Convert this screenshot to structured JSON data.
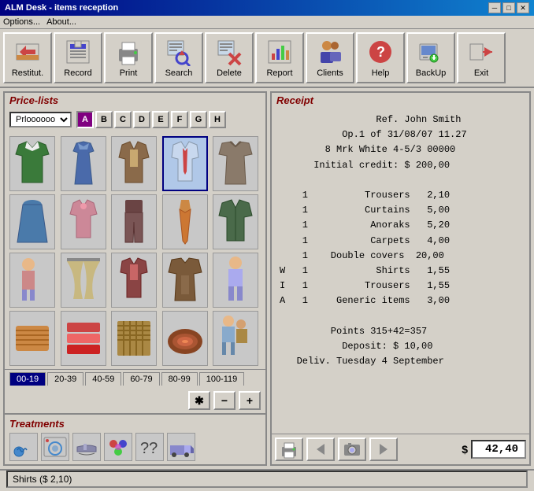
{
  "window": {
    "title": "ALM Desk - items reception",
    "minimize": "─",
    "maximize": "□",
    "close": "✕"
  },
  "menu": {
    "items": [
      "Options...",
      "About..."
    ]
  },
  "toolbar": {
    "buttons": [
      {
        "id": "restitut",
        "label": "Restitut.",
        "icon": "↩"
      },
      {
        "id": "record",
        "label": "Record",
        "icon": "💾"
      },
      {
        "id": "print",
        "label": "Print",
        "icon": "🖨"
      },
      {
        "id": "search",
        "label": "Search",
        "icon": "🔍"
      },
      {
        "id": "delete",
        "label": "Delete",
        "icon": "✂"
      },
      {
        "id": "report",
        "label": "Report",
        "icon": "📊"
      },
      {
        "id": "clients",
        "label": "Clients",
        "icon": "👥"
      },
      {
        "id": "help",
        "label": "Help",
        "icon": "?"
      },
      {
        "id": "backup",
        "label": "BackUp",
        "icon": "💻"
      },
      {
        "id": "exit",
        "label": "Exit",
        "icon": "→"
      }
    ]
  },
  "left_panel": {
    "title": "Price-lists",
    "select_value": "Prloooooo",
    "alpha_buttons": [
      "A",
      "B",
      "C",
      "D",
      "E",
      "F",
      "G",
      "H"
    ],
    "selected_alpha": "A",
    "items": [
      {
        "id": 1,
        "type": "jacket",
        "color": "#3a7a3a",
        "selected": false
      },
      {
        "id": 2,
        "type": "dress",
        "color": "#4a6aaa",
        "selected": false
      },
      {
        "id": 3,
        "type": "suit",
        "color": "#8a6a4a",
        "selected": false
      },
      {
        "id": 4,
        "type": "shirt_tie",
        "color": "#5a7aaa",
        "selected": true
      },
      {
        "id": 5,
        "type": "coat",
        "color": "#8a7a6a",
        "selected": false
      },
      {
        "id": 6,
        "type": "skirt",
        "color": "#4a7aaa",
        "selected": false
      },
      {
        "id": 7,
        "type": "blouse",
        "color": "#cc6688",
        "selected": false
      },
      {
        "id": 8,
        "type": "trousers",
        "color": "#8a4a4a",
        "selected": false
      },
      {
        "id": 9,
        "type": "tie",
        "color": "#cc8844",
        "selected": false
      },
      {
        "id": 10,
        "type": "jacket2",
        "color": "#4a6a4a",
        "selected": false
      },
      {
        "id": 11,
        "type": "figure1",
        "color": "#cc8888",
        "selected": false
      },
      {
        "id": 12,
        "type": "curtain",
        "color": "#c8b880",
        "selected": false
      },
      {
        "id": 13,
        "type": "suit2",
        "color": "#8a4a4a",
        "selected": false
      },
      {
        "id": 14,
        "type": "coat2",
        "color": "#6a4a3a",
        "selected": false
      },
      {
        "id": 15,
        "type": "blanket",
        "color": "#cc8844",
        "selected": false
      },
      {
        "id": 16,
        "type": "towels",
        "color": "#cc4444",
        "selected": false
      },
      {
        "id": 17,
        "type": "fabric",
        "color": "#aa8844",
        "selected": false
      },
      {
        "id": 18,
        "type": "carpet",
        "color": "#884422",
        "selected": false
      },
      {
        "id": 19,
        "type": "figures2",
        "color": "#8888cc",
        "selected": false
      }
    ],
    "page_tabs": [
      {
        "id": "p1",
        "label": "00-19",
        "active": true
      },
      {
        "id": "p2",
        "label": "20-39",
        "active": false
      },
      {
        "id": "p3",
        "label": "40-59",
        "active": false
      },
      {
        "id": "p4",
        "label": "60-79",
        "active": false
      },
      {
        "id": "p5",
        "label": "80-99",
        "active": false
      },
      {
        "id": "p6",
        "label": "100-119",
        "active": false
      }
    ],
    "action_buttons": [
      {
        "id": "star",
        "label": "✱"
      },
      {
        "id": "minus",
        "label": "−"
      },
      {
        "id": "plus",
        "label": "+"
      }
    ]
  },
  "treatments": {
    "title": "Treatments",
    "icons": [
      {
        "id": "wash",
        "label": "💧"
      },
      {
        "id": "machine",
        "label": "🔵"
      },
      {
        "id": "iron",
        "label": "♨"
      },
      {
        "id": "color",
        "label": "🎨"
      },
      {
        "id": "special",
        "label": "⚙"
      },
      {
        "id": "delivery",
        "label": "🚚"
      }
    ]
  },
  "receipt": {
    "title": "Receipt",
    "header": [
      "                 Ref. John Smith",
      "           Op.1 of 31/08/07 11.27",
      "        8 Mrk White 4-5/3 00000",
      "      Initial credit: $ 200,00"
    ],
    "items": [
      {
        "qty": "    1",
        "name": "     Trousers",
        "price": "  2,10"
      },
      {
        "qty": "    1",
        "name": "       Curtains",
        "price": "  5,00"
      },
      {
        "qty": "    1",
        "name": "        Anoraks",
        "price": "  5,20"
      },
      {
        "qty": "    1",
        "name": "        Carpets",
        "price": "  4,00"
      },
      {
        "qty": "    1",
        "name": " Double covers",
        "price": " 20,00"
      },
      {
        "qty": "W   1",
        "name": "         Shirts",
        "price": "  1,55"
      },
      {
        "qty": "I   1",
        "name": "        Trousers",
        "price": "  1,55"
      },
      {
        "qty": "A   1",
        "name": "  Generic items",
        "price": "  3,00"
      }
    ],
    "footer": [
      "",
      "       Points 315+42=357",
      "         Deposit: $ 10,00",
      "  Deliv. Tuesday 4 September"
    ],
    "total_label": "$",
    "total_value": "42,40",
    "controls": [
      {
        "id": "print2",
        "label": "🖨"
      },
      {
        "id": "prev",
        "label": "◀"
      },
      {
        "id": "camera",
        "label": "📷"
      },
      {
        "id": "next",
        "label": "▶"
      }
    ]
  },
  "status_bar": {
    "text": "Shirts ($ 2,10)"
  }
}
